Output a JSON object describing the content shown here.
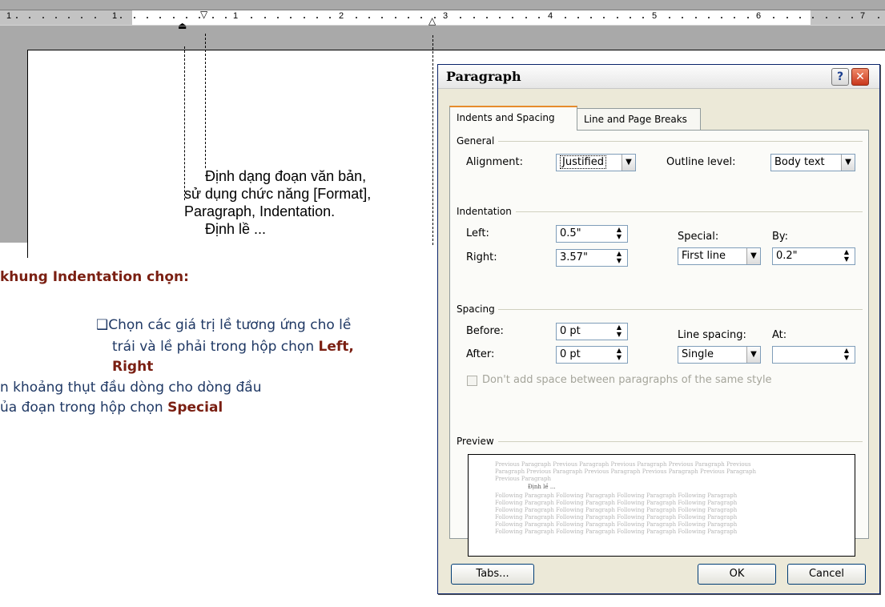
{
  "ruler": {
    "numbers": [
      "1",
      "1",
      "2",
      "3",
      "4",
      "5",
      "6",
      "7"
    ],
    "marker_symbols": {
      "left_indent": "⏏",
      "first_line": "▽",
      "right_indent": "△"
    }
  },
  "document": {
    "lines": [
      "Định dạng đoạn văn bản,",
      "sử dụng chức năng [Format],",
      "Paragraph, Indentation.",
      "Định lề ..."
    ]
  },
  "slide": {
    "heading": "khung Indentation chọn:",
    "bullet_glyph": "❑",
    "bullet_line1": "Chọn các giá trị lề tương ứng cho lề",
    "bullet_line2": "trái và lề phải trong hộp chọn ",
    "bullet_bold1": "Left,",
    "bullet_bold2": "Right",
    "line3": "n khoảng thụt đầu dòng cho dòng đầu",
    "line4_text": "ủa đoạn trong hộp chọn ",
    "line4_bold": "Special"
  },
  "dialog": {
    "title": "Paragraph",
    "help_label": "?",
    "close_label": "✕",
    "tabs": [
      {
        "label": "Indents and Spacing",
        "active": true
      },
      {
        "label": "Line and Page Breaks",
        "active": false
      }
    ],
    "general": {
      "group_label": "General",
      "alignment_label": "Alignment:",
      "alignment_value": "Justified",
      "outline_label": "Outline level:",
      "outline_value": "Body text"
    },
    "indentation": {
      "group_label": "Indentation",
      "left_label": "Left:",
      "left_value": "0.5\"",
      "right_label": "Right:",
      "right_value": "3.57\"",
      "special_label": "Special:",
      "special_value": "First line",
      "by_label": "By:",
      "by_value": "0.2\""
    },
    "spacing": {
      "group_label": "Spacing",
      "before_label": "Before:",
      "before_value": "0 pt",
      "after_label": "After:",
      "after_value": "0 pt",
      "line_spacing_label": "Line spacing:",
      "line_spacing_value": "Single",
      "at_label": "At:",
      "at_value": "",
      "checkbox_label": "Don't add space between paragraphs of the same style"
    },
    "preview": {
      "group_label": "Preview",
      "prev_lines": [
        "Previous Paragraph Previous Paragraph Previous Paragraph Previous Paragraph Previous",
        "Paragraph Previous Paragraph Previous Paragraph Previous Paragraph Previous Paragraph",
        "Previous Paragraph"
      ],
      "current_line": "Định lề ...",
      "follow_lines": [
        "Following Paragraph Following Paragraph Following Paragraph Following Paragraph",
        "Following Paragraph Following Paragraph Following Paragraph Following Paragraph",
        "Following Paragraph Following Paragraph Following Paragraph Following Paragraph",
        "Following Paragraph Following Paragraph Following Paragraph Following Paragraph",
        "Following Paragraph Following Paragraph Following Paragraph Following Paragraph",
        "Following Paragraph Following Paragraph Following Paragraph Following Paragraph"
      ]
    },
    "buttons": {
      "tabs": "Tabs...",
      "ok": "OK",
      "cancel": "Cancel"
    }
  }
}
